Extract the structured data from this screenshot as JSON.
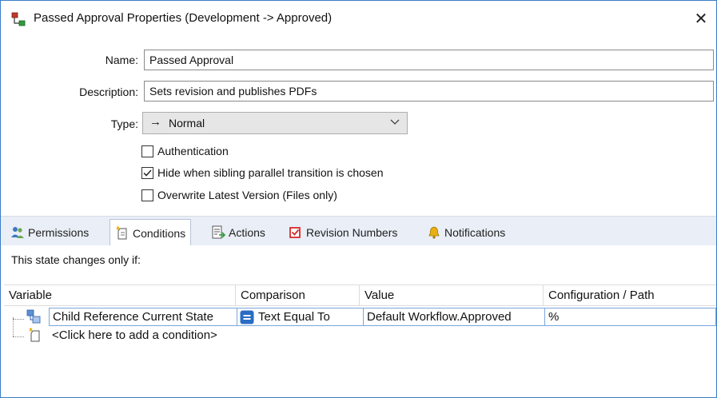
{
  "window": {
    "title": "Passed Approval Properties (Development -> Approved)",
    "close_glyph": "✕"
  },
  "form": {
    "name_label": "Name:",
    "name_value": "Passed Approval",
    "description_label": "Description:",
    "description_value": "Sets revision and publishes PDFs",
    "type_label": "Type:",
    "type_arrow": "→",
    "type_value": "Normal",
    "checkboxes": [
      {
        "label": "Authentication",
        "checked": false
      },
      {
        "label": "Hide when sibling parallel transition is chosen",
        "checked": true
      },
      {
        "label": "Overwrite Latest Version (Files only)",
        "checked": false
      }
    ]
  },
  "tabs": [
    {
      "label": "Permissions",
      "icon": "users-icon",
      "active": false
    },
    {
      "label": "Conditions",
      "icon": "conditions-icon",
      "active": true
    },
    {
      "label": "Actions",
      "icon": "actions-icon",
      "active": false
    },
    {
      "label": "Revision Numbers",
      "icon": "revision-checkbox-icon",
      "active": false
    },
    {
      "label": "Notifications",
      "icon": "bell-icon",
      "active": false
    }
  ],
  "conditions": {
    "description": "This state changes only if:",
    "columns": [
      "Variable",
      "Comparison",
      "Value",
      "Configuration / Path"
    ],
    "rows": [
      {
        "variable": "Child Reference Current State",
        "comparison": "Text Equal To",
        "comparison_icon": "equals-icon",
        "value": "Default Workflow.Approved",
        "config": "%"
      }
    ],
    "add_prompt": "<Click here to add a condition>"
  },
  "colors": {
    "accent_blue": "#2b6cc4",
    "tab_strip": "#e9eef7",
    "revision_red": "#d62b2b",
    "bell_yellow": "#e8b012",
    "workflow_green": "#2e9c3a",
    "workflow_red": "#c0392b"
  }
}
